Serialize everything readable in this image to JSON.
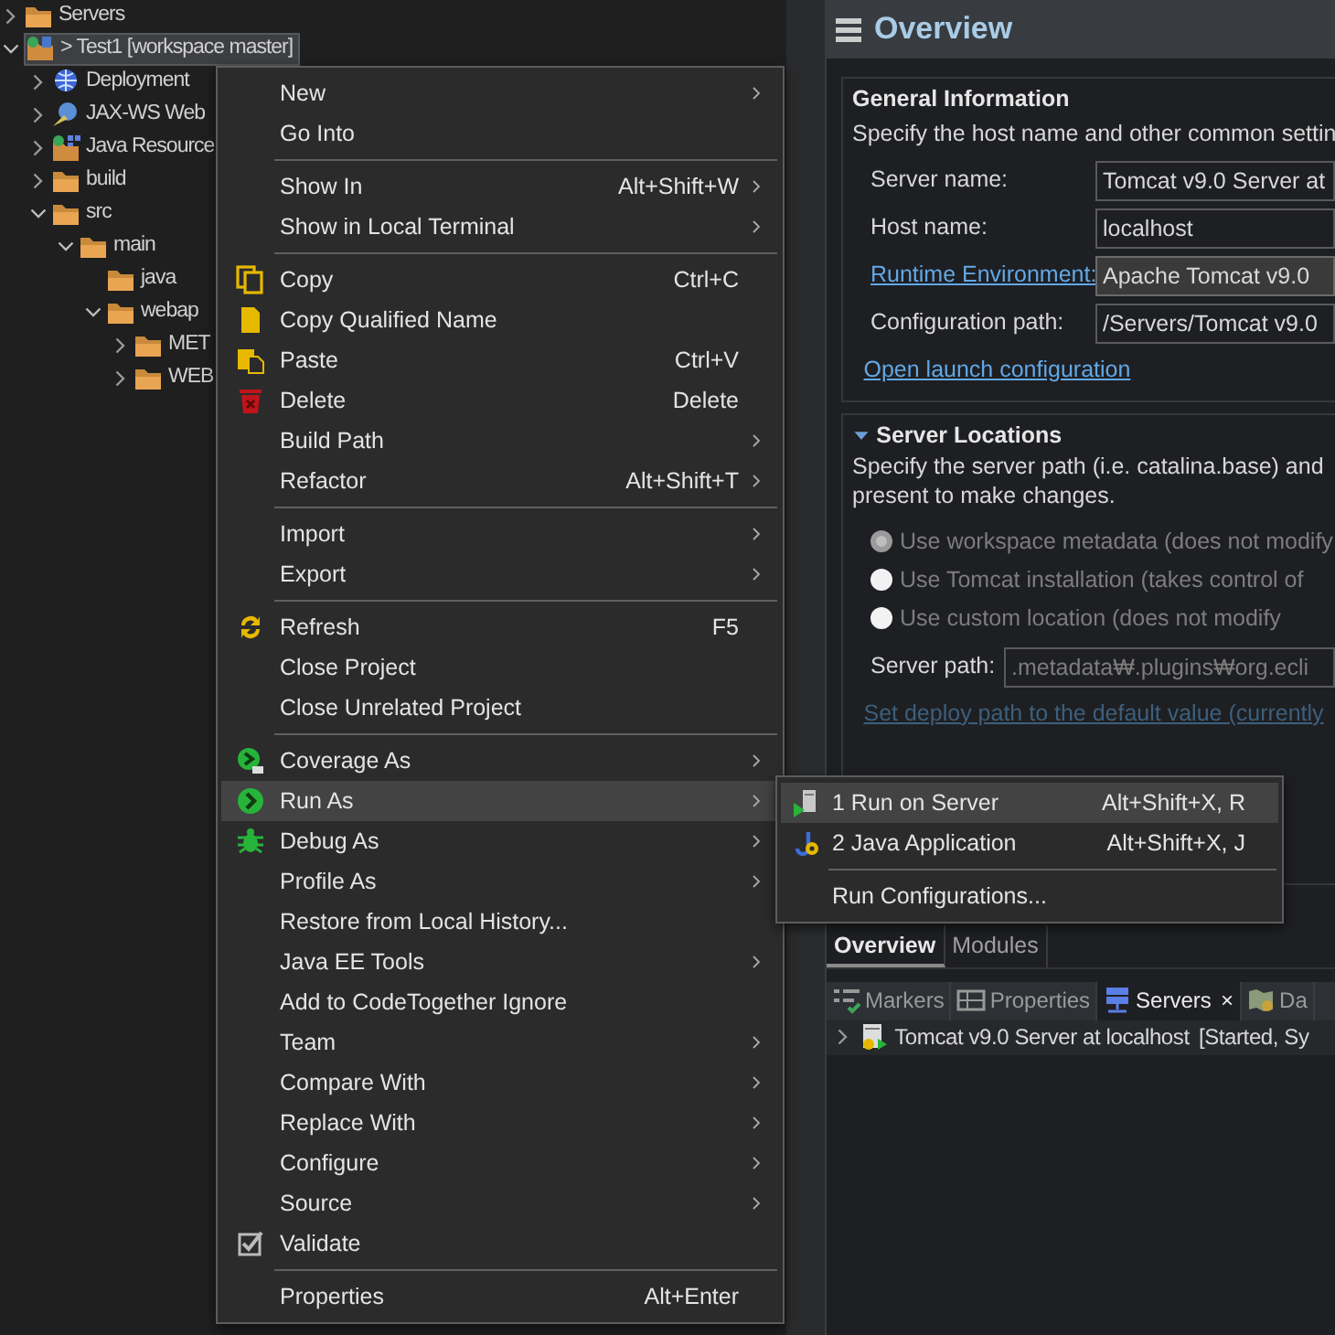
{
  "tree": [
    {
      "label": "Servers",
      "kind": "folder",
      "expanded": false,
      "selected": false
    },
    {
      "label": "> Test1 [workspace master]",
      "kind": "project",
      "expanded": true,
      "selected": true,
      "children": [
        {
          "label": "Deployment",
          "kind": "globe",
          "expanded": false,
          "selected": false
        },
        {
          "label": "JAX-WS Web",
          "kind": "service",
          "expanded": false,
          "selected": false
        },
        {
          "label": "Java Resource",
          "kind": "library",
          "expanded": false,
          "selected": false
        },
        {
          "label": "build",
          "kind": "folder",
          "expanded": false,
          "selected": false
        },
        {
          "label": "src",
          "kind": "folder",
          "expanded": true,
          "selected": false,
          "children": [
            {
              "label": "main",
              "kind": "folder",
              "expanded": true,
              "selected": false,
              "children": [
                {
                  "label": "java",
                  "kind": "folder",
                  "selected": false
                },
                {
                  "label": "webap",
                  "kind": "folder",
                  "expanded": true,
                  "selected": false,
                  "children": [
                    {
                      "label": "MET",
                      "kind": "folder",
                      "expanded": false,
                      "selected": false
                    },
                    {
                      "label": "WEB",
                      "kind": "folder",
                      "expanded": false,
                      "selected": false
                    }
                  ]
                }
              ]
            }
          ]
        }
      ]
    }
  ],
  "context_menu": [
    {
      "kind": "item",
      "label": "New",
      "submenu": true,
      "selected": false
    },
    {
      "kind": "item",
      "label": "Go Into",
      "submenu": false,
      "selected": false
    },
    {
      "kind": "separator"
    },
    {
      "kind": "item",
      "label": "Show In",
      "shortcut": "Alt+Shift+W",
      "submenu": true,
      "selected": false
    },
    {
      "kind": "item",
      "label": "Show in Local Terminal",
      "submenu": true,
      "selected": false
    },
    {
      "kind": "separator"
    },
    {
      "kind": "item",
      "label": "Copy",
      "shortcut": "Ctrl+C",
      "submenu": false,
      "selected": false
    },
    {
      "kind": "item",
      "label": "Copy Qualified Name",
      "submenu": false,
      "selected": false
    },
    {
      "kind": "item",
      "label": "Paste",
      "shortcut": "Ctrl+V",
      "submenu": false,
      "selected": false
    },
    {
      "kind": "item",
      "label": "Delete",
      "shortcut": "Delete",
      "submenu": false,
      "selected": false
    },
    {
      "kind": "item",
      "label": "Build Path",
      "submenu": true,
      "selected": false
    },
    {
      "kind": "item",
      "label": "Refactor",
      "shortcut": "Alt+Shift+T",
      "submenu": true,
      "selected": false
    },
    {
      "kind": "separator"
    },
    {
      "kind": "item",
      "label": "Import",
      "submenu": true,
      "selected": false
    },
    {
      "kind": "item",
      "label": "Export",
      "submenu": true,
      "selected": false
    },
    {
      "kind": "separator"
    },
    {
      "kind": "item",
      "label": "Refresh",
      "shortcut": "F5",
      "submenu": false,
      "selected": false
    },
    {
      "kind": "item",
      "label": "Close Project",
      "submenu": false,
      "selected": false
    },
    {
      "kind": "item",
      "label": "Close Unrelated Project",
      "submenu": false,
      "selected": false
    },
    {
      "kind": "separator"
    },
    {
      "kind": "item",
      "label": "Coverage As",
      "submenu": true,
      "selected": false
    },
    {
      "kind": "item",
      "label": "Run As",
      "submenu": true,
      "selected": true
    },
    {
      "kind": "item",
      "label": "Debug As",
      "submenu": true,
      "selected": false
    },
    {
      "kind": "item",
      "label": "Profile As",
      "submenu": true,
      "selected": false
    },
    {
      "kind": "item",
      "label": "Restore from Local History...",
      "submenu": false,
      "selected": false
    },
    {
      "kind": "item",
      "label": "Java EE Tools",
      "submenu": true,
      "selected": false
    },
    {
      "kind": "item",
      "label": "Add to CodeTogether Ignore",
      "submenu": false,
      "selected": false
    },
    {
      "kind": "item",
      "label": "Team",
      "submenu": true,
      "selected": false
    },
    {
      "kind": "item",
      "label": "Compare With",
      "submenu": true,
      "selected": false
    },
    {
      "kind": "item",
      "label": "Replace With",
      "submenu": true,
      "selected": false
    },
    {
      "kind": "item",
      "label": "Configure",
      "submenu": true,
      "selected": false
    },
    {
      "kind": "item",
      "label": "Source",
      "submenu": true,
      "selected": false
    },
    {
      "kind": "item",
      "label": "Validate",
      "submenu": false,
      "selected": false
    },
    {
      "kind": "separator"
    },
    {
      "kind": "item",
      "label": "Properties",
      "shortcut": "Alt+Enter",
      "submenu": false,
      "selected": false
    }
  ],
  "run_as_submenu": [
    {
      "kind": "item",
      "label": "1 Run on Server",
      "shortcut": "Alt+Shift+X, R",
      "selected": true
    },
    {
      "kind": "item",
      "label": "2 Java Application",
      "shortcut": "Alt+Shift+X, J",
      "selected": false
    },
    {
      "kind": "separator"
    },
    {
      "kind": "item",
      "label": "Run Configurations...",
      "selected": false
    }
  ],
  "editor": {
    "title": "Overview",
    "general": {
      "heading": "General Information",
      "description": "Specify the host name and other common settin",
      "fields": [
        {
          "label": "Server name:",
          "value": "Tomcat v9.0 Server at",
          "kind": "text"
        },
        {
          "label": "Host name:",
          "value": "localhost",
          "kind": "text"
        },
        {
          "label": "Runtime Environment:",
          "value": "Apache Tomcat v9.0",
          "kind": "combo"
        },
        {
          "label": "Configuration path:",
          "value": "/Servers/Tomcat v9.0",
          "kind": "text"
        }
      ],
      "link": "Open launch configuration"
    },
    "locations": {
      "heading": "Server Locations",
      "expanded": true,
      "description": "Specify the server path (i.e. catalina.base) and",
      "description_2": "present to make changes.",
      "options": [
        {
          "label": "Use workspace metadata (does not modify",
          "selected": true,
          "disabled": true
        },
        {
          "label": "Use Tomcat installation (takes control of",
          "selected": false,
          "disabled": true
        },
        {
          "label": "Use custom location (does not modify",
          "selected": false,
          "disabled": true
        }
      ],
      "path_label": "Server path:",
      "path_value": ".metadata₩.plugins₩org.ecli",
      "link": "Set deploy path to the default value (currently"
    },
    "tabs": [
      {
        "label": "Overview",
        "selected": true
      },
      {
        "label": "Modules",
        "selected": false
      }
    ]
  },
  "views": {
    "tabs": [
      {
        "label": "Markers",
        "selected": false
      },
      {
        "label": "Properties",
        "selected": false
      },
      {
        "label": "Servers",
        "selected": true,
        "close": "×"
      },
      {
        "label": "Da",
        "selected": false
      }
    ],
    "rows": [
      {
        "label": "Tomcat v9.0 Server at localhost",
        "status": "[Started, Sy",
        "expanded": false
      }
    ]
  }
}
